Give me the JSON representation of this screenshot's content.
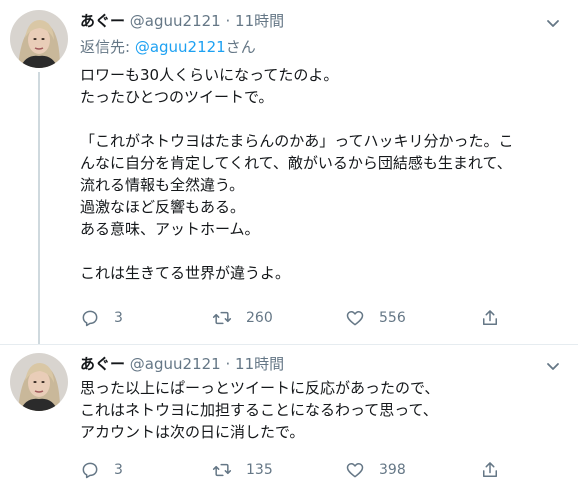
{
  "tweets": [
    {
      "name": "あぐー",
      "handle": "@aguu2121",
      "separator": "·",
      "time": "11時間",
      "reply_to_prefix": "返信先: ",
      "reply_to_handle": "@aguu2121",
      "reply_to_suffix": "さん",
      "lines": [
        "ロワーも30人くらいになってたのよ。",
        "たったひとつのツイートで。",
        "",
        "「これがネトウヨはたまらんのかあ」ってハッキリ分かった。こ",
        "んなに自分を肯定してくれて、敵がいるから団結感も生まれて、",
        "流れる情報も全然違う。",
        "過激なほど反響もある。",
        "ある意味、アットホーム。",
        "",
        "これは生きてる世界が違うよ。"
      ],
      "replies": "3",
      "retweets": "260",
      "likes": "556"
    },
    {
      "name": "あぐー",
      "handle": "@aguu2121",
      "separator": "·",
      "time": "11時間",
      "lines": [
        "思った以上にぱーっとツイートに反応があったので、",
        "これはネトウヨに加担することになるわって思って、",
        "アカウントは次の日に消したで。"
      ],
      "replies": "3",
      "retweets": "135",
      "likes": "398"
    }
  ],
  "icons": {
    "caret": "chevron-down-icon",
    "reply": "reply-icon",
    "retweet": "retweet-icon",
    "like": "heart-icon",
    "share": "share-icon"
  },
  "colors": {
    "text": "#14171a",
    "secondary": "#657786",
    "link": "#1da1f2",
    "thread_line": "#cfd9de",
    "divider": "#e6ecf0"
  }
}
